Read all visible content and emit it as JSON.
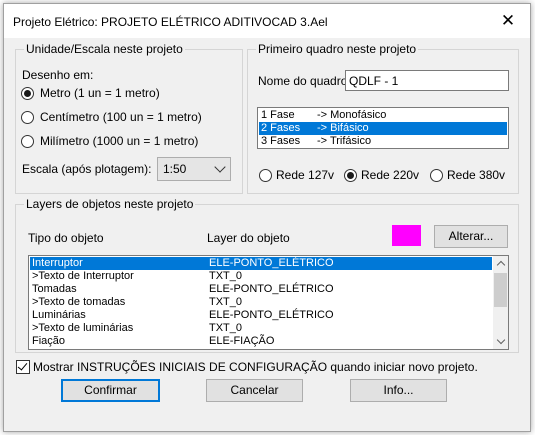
{
  "window": {
    "title": "Projeto Elétrico: PROJETO ELÉTRICO ADITIVOCAD 3.Ael",
    "close_symbol": "✕"
  },
  "units_group": {
    "legend": "Unidade/Escala neste projeto",
    "drawing_label": "Desenho em:",
    "options": [
      {
        "label": "Metro (1 un = 1 metro)",
        "selected": true
      },
      {
        "label": "Centímetro (100 un = 1 metro)",
        "selected": false
      },
      {
        "label": "Milímetro (1000 un = 1 metro)",
        "selected": false
      }
    ],
    "scale_label": "Escala (após plotagem):",
    "scale_value": "1:50"
  },
  "panel_group": {
    "legend": "Primeiro quadro neste projeto",
    "name_label": "Nome do quadro:",
    "name_value": "QDLF - 1",
    "phases": [
      {
        "left": "1 Fase",
        "right": "-> Monofásico",
        "selected": false
      },
      {
        "left": "2 Fases",
        "right": "-> Bifásico",
        "selected": true
      },
      {
        "left": "3 Fases",
        "right": "-> Trifásico",
        "selected": false
      }
    ],
    "networks": [
      {
        "label": "Rede 127v",
        "selected": false
      },
      {
        "label": "Rede 220v",
        "selected": true
      },
      {
        "label": "Rede 380v",
        "selected": false
      }
    ]
  },
  "layers_group": {
    "legend": "Layers de objetos neste projeto",
    "col_type": "Tipo do objeto",
    "col_layer": "Layer do objeto",
    "swatch_color": "#ff00ff",
    "change_button": "Alterar...",
    "rows": [
      {
        "type": "Interruptor",
        "layer": "ELE-PONTO_ELÉTRICO",
        "selected": true
      },
      {
        "type": " >Texto de Interruptor",
        "layer": "TXT_0",
        "selected": false
      },
      {
        "type": "Tomadas",
        "layer": "ELE-PONTO_ELÉTRICO",
        "selected": false
      },
      {
        "type": " >Texto de tomadas",
        "layer": "TXT_0",
        "selected": false
      },
      {
        "type": "Luminárias",
        "layer": "ELE-PONTO_ELÉTRICO",
        "selected": false
      },
      {
        "type": " >Texto de luminárias",
        "layer": "TXT_0",
        "selected": false
      },
      {
        "type": "Fiação",
        "layer": "ELE-FIAÇÃO",
        "selected": false
      }
    ]
  },
  "show_instructions": {
    "label": "Mostrar INSTRUÇÕES INICIAIS DE CONFIGURAÇÃO quando iniciar novo projeto.",
    "checked": true
  },
  "buttons": {
    "confirm": "Confirmar",
    "cancel": "Cancelar",
    "info": "Info..."
  }
}
